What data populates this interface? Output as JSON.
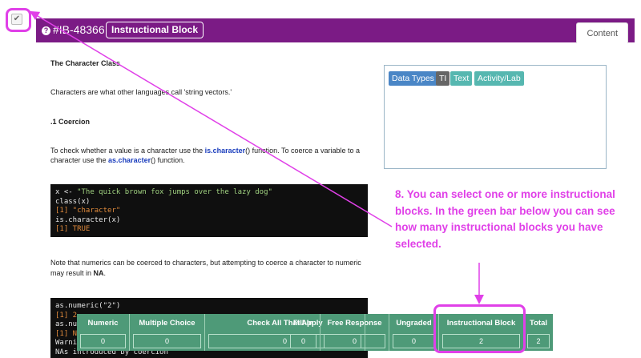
{
  "block": {
    "id": "#IB-48366",
    "type": "Instructional Block",
    "selected": true
  },
  "tabs": {
    "content": "Content"
  },
  "content": {
    "heading1": "The Character Class",
    "para1": "Characters are what other languages call 'string vectors.'",
    "heading2": ".1 Coercion",
    "para2_line1_pre": "To check whether a value is a character use the ",
    "para2_fn1": "is.character",
    "para2_line1_post": "() function. To coerce a variable to a",
    "para2_line2_pre": "character use the ",
    "para2_fn2": "as.character",
    "para2_line2_post": "() function.",
    "code1": [
      "x <- \"The quick brown fox jumps over the lazy dog\"",
      "class(x)",
      "[1] \"character\"",
      "is.character(x)",
      "[1] TRUE"
    ],
    "para3_line1": "Note that numerics can be coerced to characters, but attempting to coerce a character to numeric",
    "para3_line2_pre": "may result in ",
    "para3_na": "NA",
    "para3_line2_post": ".",
    "code2": [
      "as.numeric(\"2\")",
      "[1] 2",
      "as.nume",
      "[1] NA",
      "Warning",
      "NAs introduced by coercion"
    ]
  },
  "tags": [
    {
      "label": "Data Types",
      "color": "#4a86c6"
    },
    {
      "label": "TI",
      "color": "#666666"
    },
    {
      "label": "Text",
      "color": "#56b7b0"
    },
    {
      "label": "Activity/Lab",
      "color": "#56b7b0"
    }
  ],
  "annotation": "8. You can select one or more instructional blocks. In the green bar below you can see how many instructional blocks you have selected.",
  "summary_bar": {
    "columns": [
      {
        "label": "Numeric",
        "count": "0"
      },
      {
        "label": "Multiple Choice",
        "count": "0"
      },
      {
        "label": "Check All That Apply",
        "count": "0"
      },
      {
        "label": "Fill-In",
        "count": "0"
      },
      {
        "label": "Free Response",
        "count": "0"
      },
      {
        "label": "Ungraded",
        "count": "0"
      },
      {
        "label": "Instructional Block",
        "count": "2"
      },
      {
        "label": "Total",
        "count": "2"
      }
    ]
  },
  "colors": {
    "header": "#7b1b85",
    "annotation": "#e040e8",
    "summary_bar": "#4e9a78"
  }
}
